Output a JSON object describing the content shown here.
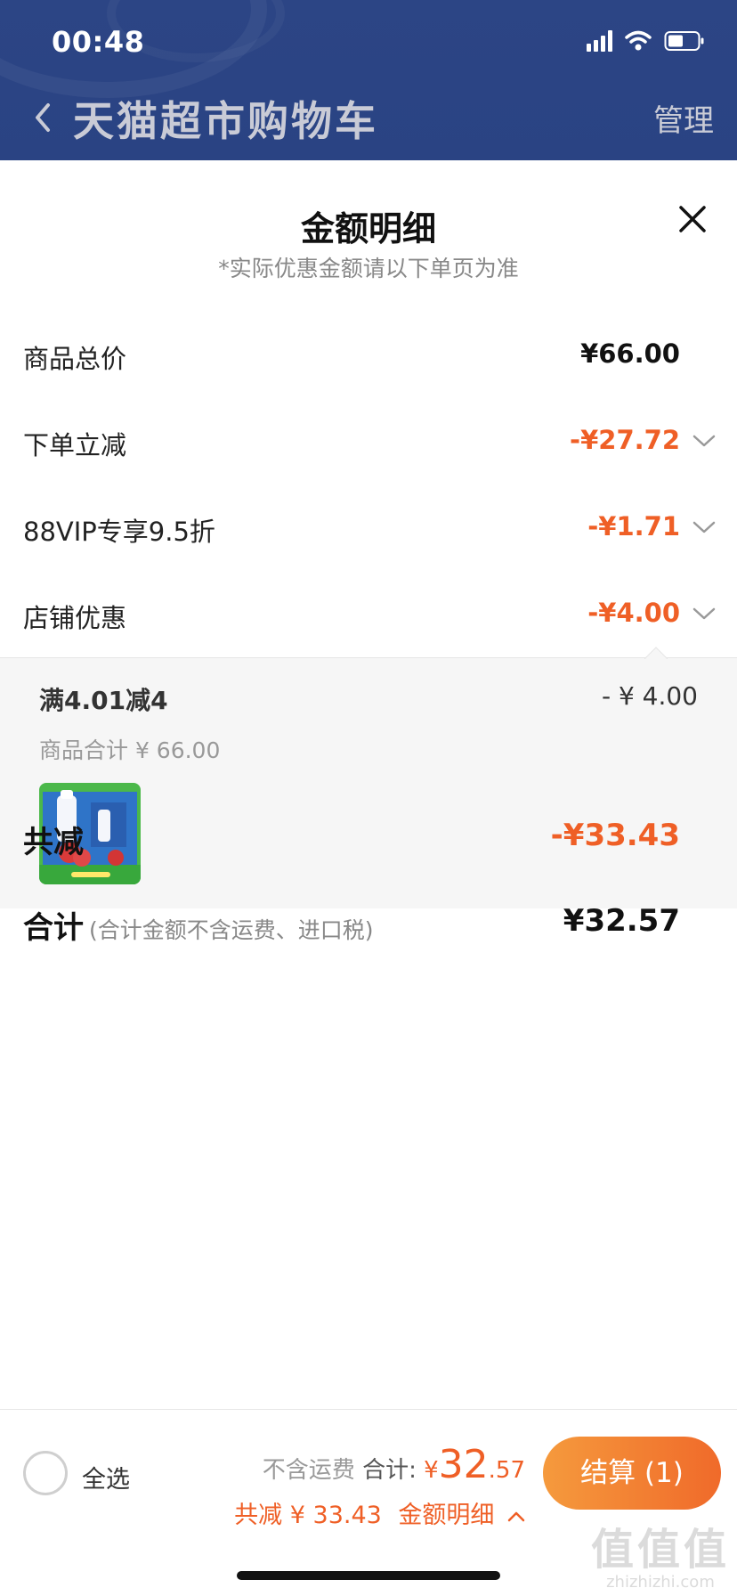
{
  "status_bar": {
    "time": "00:48"
  },
  "header": {
    "title": "天猫超市购物车",
    "manage_label": "管理"
  },
  "sheet": {
    "title": "金额明细",
    "subtitle": "*实际优惠金额请以下单页为准",
    "rows": [
      {
        "label": "商品总价",
        "value": "¥66.00"
      },
      {
        "label": "下单立减",
        "value": "-¥27.72"
      },
      {
        "label": "88VIP专享9.5折",
        "value": "-¥1.71"
      },
      {
        "label": "店铺优惠",
        "value": "-¥4.00"
      }
    ],
    "store_discount_detail": {
      "title": "满4.01减4",
      "amount": "- ¥ 4.00",
      "subtotal": "商品合计 ¥ 66.00"
    },
    "total_discount": {
      "label": "共减",
      "value": "-¥33.43"
    },
    "total": {
      "label": "合计",
      "note": "(合计金额不含运费、进口税)",
      "value": "¥32.57"
    }
  },
  "bottom_bar": {
    "select_all_label": "全选",
    "shipping_note": "不含运费",
    "total_label": "合计:",
    "currency": "¥",
    "total_int": "32",
    "total_dec": ".57",
    "discount_text": "共减 ¥ 33.43",
    "details_link": "金额明细",
    "checkout_label": "结算 (1)"
  },
  "watermark": {
    "main": "值值值",
    "sub": "zhizhizhi.com"
  },
  "colors": {
    "header_bg": "#2c4585",
    "accent": "#ef5f26",
    "button_start": "#f59a3d",
    "button_end": "#f06a2a"
  },
  "icons": [
    "back-arrow-icon",
    "close-icon",
    "chevron-down-icon",
    "chevron-up-icon",
    "signal-icon",
    "wifi-icon",
    "battery-icon"
  ]
}
